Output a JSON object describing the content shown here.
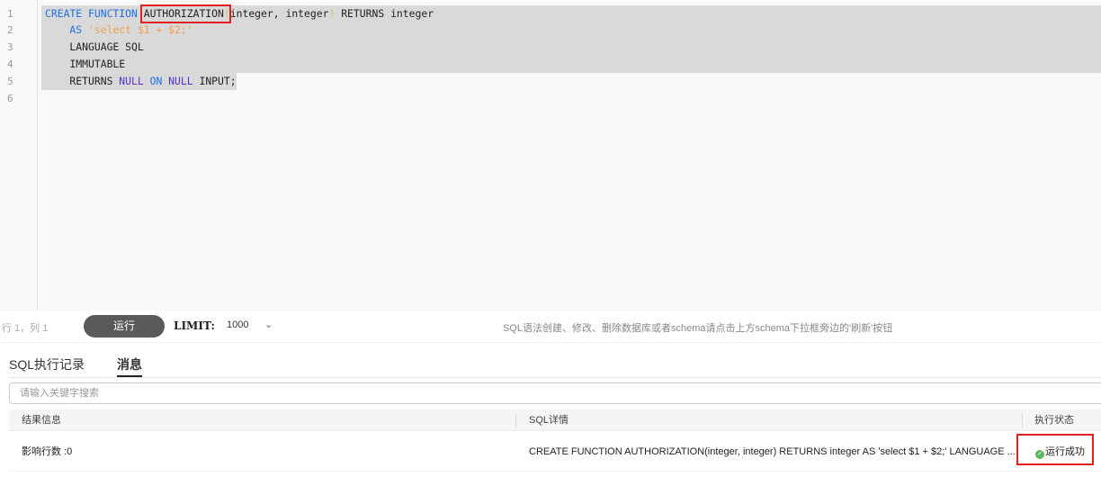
{
  "editor": {
    "line_numbers": [
      "1",
      "2",
      "3",
      "4",
      "5",
      "6"
    ],
    "lines": [
      [
        {
          "t": "CREATE FUNCTION ",
          "c": "kw"
        },
        {
          "t": "AUTHORIZATION",
          "c": ""
        },
        {
          "t": "(",
          "c": "paren"
        },
        {
          "t": "integer, integer",
          "c": ""
        },
        {
          "t": ")",
          "c": "paren"
        },
        {
          "t": " RETURNS integer",
          "c": ""
        }
      ],
      [
        {
          "t": "    AS ",
          "c": "kw"
        },
        {
          "t": "'select $1 + $2;'",
          "c": "str"
        }
      ],
      [
        {
          "t": "    LANGUAGE SQL",
          "c": ""
        }
      ],
      [
        {
          "t": "    IMMUTABLE",
          "c": ""
        }
      ],
      [
        {
          "t": "    RETURNS ",
          "c": ""
        },
        {
          "t": "NULL ",
          "c": "kw2"
        },
        {
          "t": "ON ",
          "c": "kw"
        },
        {
          "t": "NULL ",
          "c": "kw2"
        },
        {
          "t": "INPUT;",
          "c": ""
        }
      ],
      []
    ]
  },
  "toolbar": {
    "position": "行 1，列 1",
    "run_label": "运行",
    "limit_label": "LIMIT:",
    "limit_value": "1000",
    "hint": "SQL语法创建、修改、删除数据库或者schema请点击上方schema下拉框旁边的'刷新'按钮"
  },
  "tabs": [
    {
      "label": "SQL执行记录"
    },
    {
      "label": "消息"
    }
  ],
  "search": {
    "placeholder": "请输入关键字搜索"
  },
  "table": {
    "headers": [
      "结果信息",
      "SQL详情",
      "执行状态"
    ],
    "rows": [
      {
        "result": "影响行数 :0",
        "sql": "CREATE FUNCTION AUTHORIZATION(integer, integer) RETURNS integer AS 'select $1 + $2;' LANGUAGE ...",
        "status": "运行成功"
      }
    ]
  },
  "colors": {
    "keyword": "#1f6fe6",
    "string": "#f0a050",
    "success": "#5cb85c",
    "highlight": "#e02020"
  }
}
